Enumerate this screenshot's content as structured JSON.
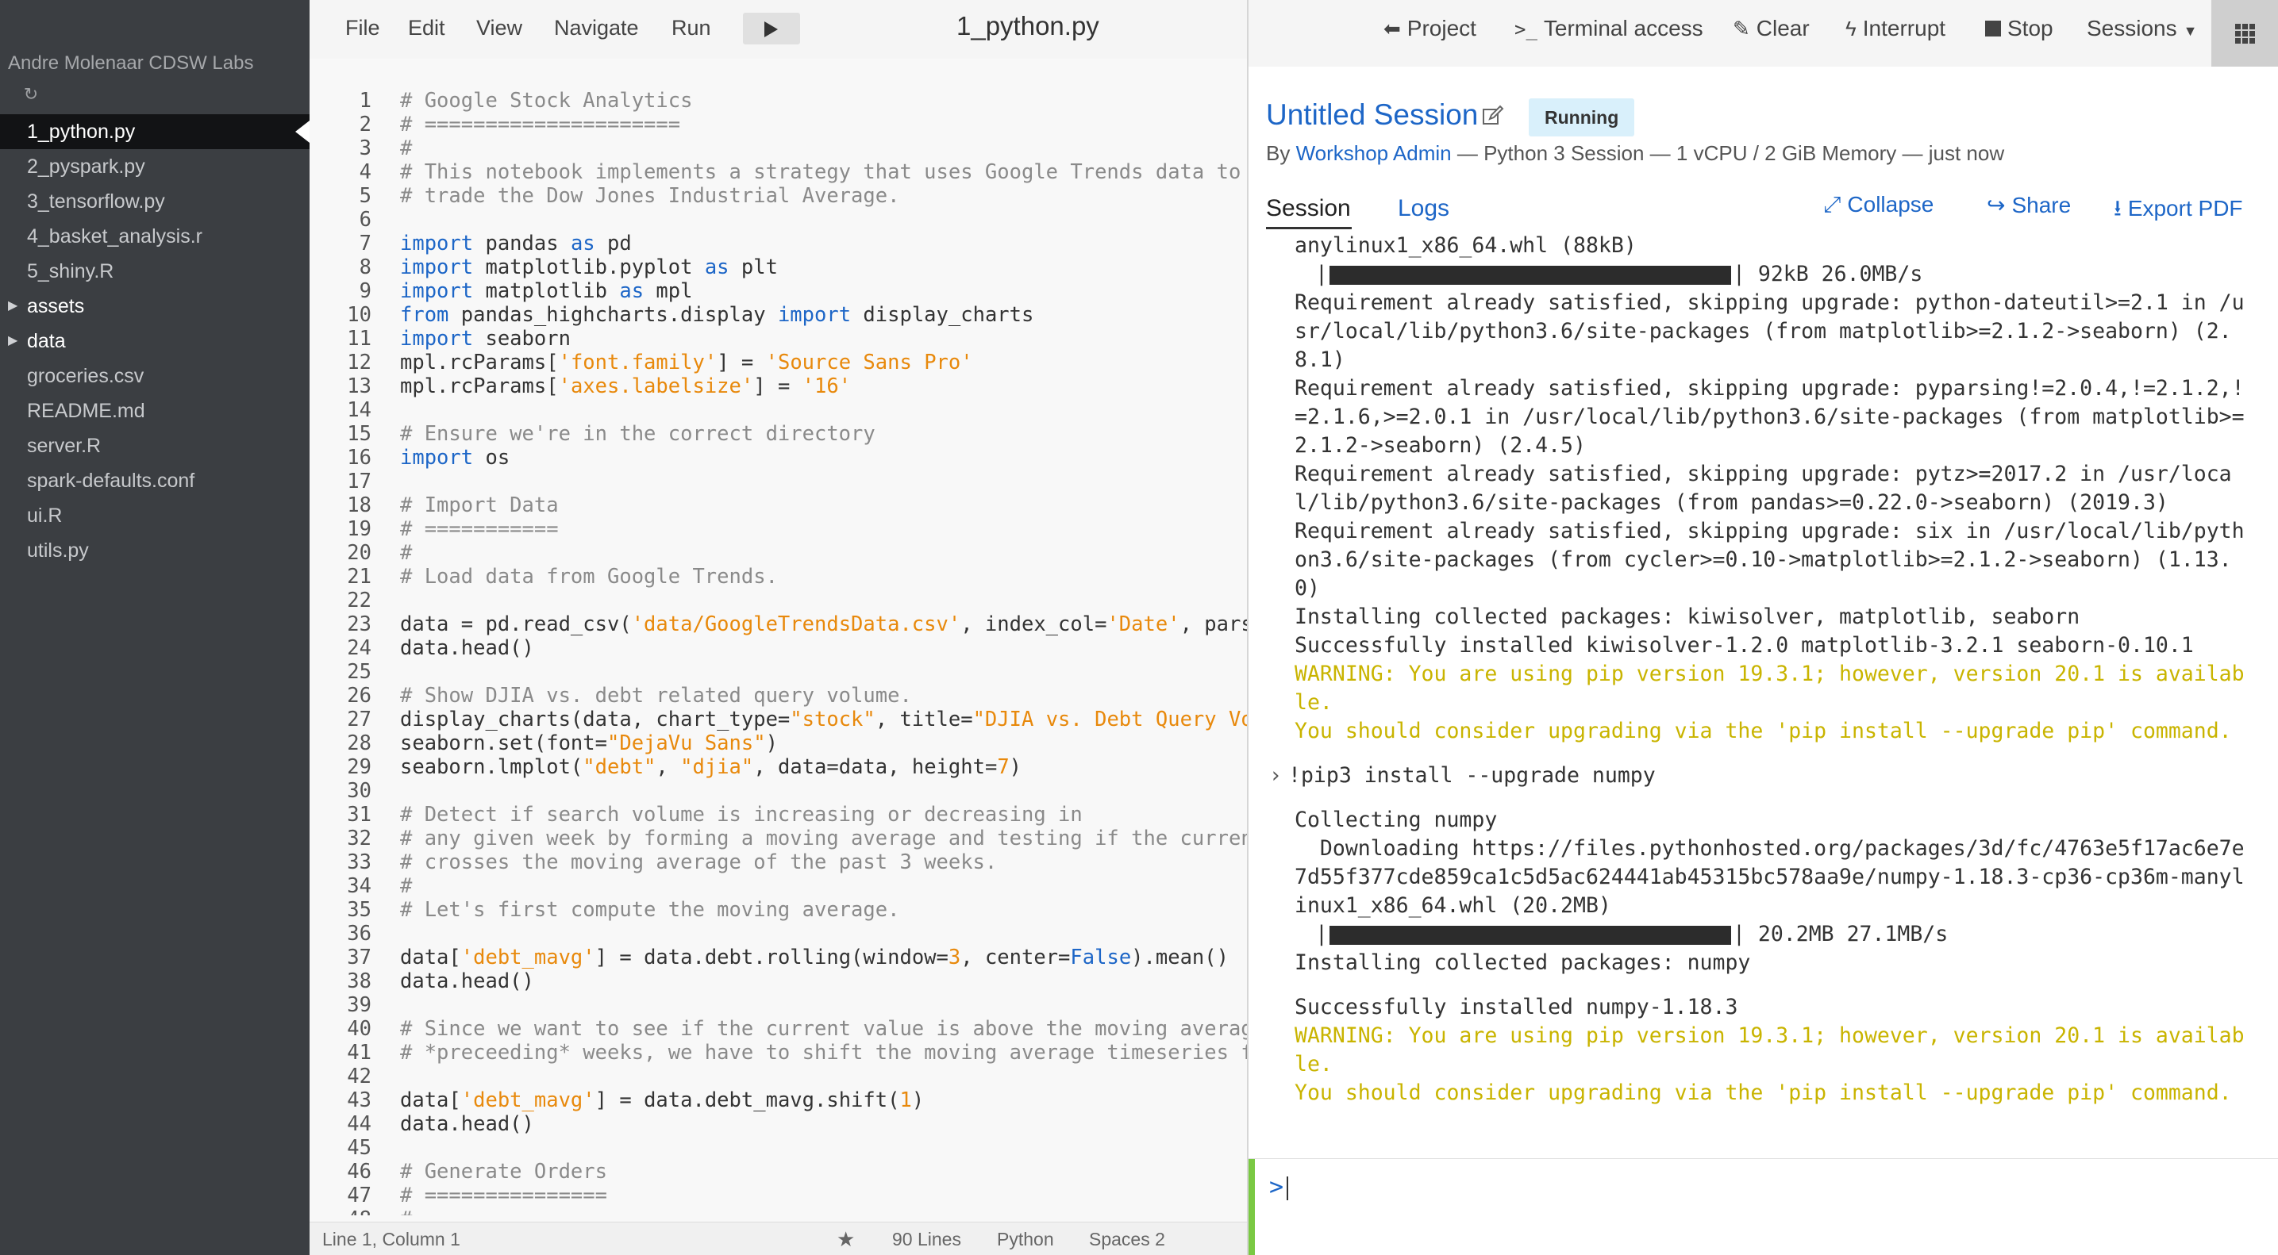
{
  "sidebar": {
    "project_title": "Andre Molenaar CDSW Labs",
    "refresh_icon": "refresh-icon",
    "files": [
      {
        "label": "1_python.py",
        "type": "file",
        "active": true
      },
      {
        "label": "2_pyspark.py",
        "type": "file"
      },
      {
        "label": "3_tensorflow.py",
        "type": "file"
      },
      {
        "label": "4_basket_analysis.r",
        "type": "file"
      },
      {
        "label": "5_shiny.R",
        "type": "file"
      },
      {
        "label": "assets",
        "type": "folder"
      },
      {
        "label": "data",
        "type": "folder"
      },
      {
        "label": "groceries.csv",
        "type": "file"
      },
      {
        "label": "README.md",
        "type": "file"
      },
      {
        "label": "server.R",
        "type": "file"
      },
      {
        "label": "spark-defaults.conf",
        "type": "file"
      },
      {
        "label": "ui.R",
        "type": "file"
      },
      {
        "label": "utils.py",
        "type": "file"
      }
    ]
  },
  "editor": {
    "menu": {
      "file": "File",
      "edit": "Edit",
      "view": "View",
      "navigate": "Navigate",
      "run": "Run"
    },
    "file_title": "1_python.py",
    "code_lines": [
      "# Google Stock Analytics",
      "# =====================",
      "#",
      "# This notebook implements a strategy that uses Google Trends data to",
      "# trade the Dow Jones Industrial Average.",
      "",
      "import pandas as pd",
      "import matplotlib.pyplot as plt",
      "import matplotlib as mpl",
      "from pandas_highcharts.display import display_charts",
      "import seaborn",
      "mpl.rcParams['font.family'] = 'Source Sans Pro'",
      "mpl.rcParams['axes.labelsize'] = '16'",
      "",
      "# Ensure we're in the correct directory",
      "import os",
      "",
      "# Import Data",
      "# ===========",
      "#",
      "# Load data from Google Trends.",
      "",
      "data = pd.read_csv('data/GoogleTrendsData.csv', index_col='Date', parse_dates=True)",
      "data.head()",
      "",
      "# Show DJIA vs. debt related query volume.",
      "display_charts(data, chart_type=\"stock\", title=\"DJIA vs. Debt Query Volume\", secondary_y=\"debt\")",
      "seaborn.set(font=\"DejaVu Sans\")",
      "seaborn.lmplot(\"debt\", \"djia\", data=data, height=7)",
      "",
      "# Detect if search volume is increasing or decreasing in",
      "# any given week by forming a moving average and testing if the current value",
      "# crosses the moving average of the past 3 weeks.",
      "#",
      "# Let's first compute the moving average.",
      "",
      "data['debt_mavg'] = data.debt.rolling(window=3, center=False).mean()",
      "data.head()",
      "",
      "# Since we want to see if the current value is above the moving average of the",
      "# *preceeding* weeks, we have to shift the moving average timeseries forward by one.",
      "",
      "data['debt_mavg'] = data.debt_mavg.shift(1)",
      "data.head()",
      "",
      "# Generate Orders",
      "# ===============",
      "#"
    ],
    "status": {
      "position": "Line 1, Column 1",
      "lines": "90 Lines",
      "language": "Python",
      "indent": "Spaces  2"
    }
  },
  "session": {
    "actions": {
      "project": "Project",
      "terminal": "Terminal access",
      "clear": "Clear",
      "interrupt": "Interrupt",
      "stop": "Stop",
      "sessions": "Sessions"
    },
    "title": "Untitled Session",
    "status": "Running",
    "meta_prefix": "By ",
    "author": "Workshop Admin",
    "meta_rest": " — Python 3 Session — 1 vCPU / 2 GiB Memory — just now",
    "tabs": {
      "session": "Session",
      "logs": "Logs"
    },
    "panel_actions": {
      "collapse": "Collapse",
      "share": "Share",
      "export": "Export PDF"
    },
    "output_block1": [
      {
        "t": "anylinux1_x86_64.whl (88kB)"
      },
      {
        "t": "92kB 26.0MB/s",
        "bar": true
      },
      {
        "t": "Requirement already satisfied, skipping upgrade: python-dateutil>=2.1 in /u"
      },
      {
        "t": "sr/local/lib/python3.6/site-packages (from matplotlib>=2.1.2->seaborn) (2."
      },
      {
        "t": "8.1)"
      },
      {
        "t": "Requirement already satisfied, skipping upgrade: pyparsing!=2.0.4,!=2.1.2,!"
      },
      {
        "t": "=2.1.6,>=2.0.1 in /usr/local/lib/python3.6/site-packages (from matplotlib>="
      },
      {
        "t": "2.1.2->seaborn) (2.4.5)"
      },
      {
        "t": "Requirement already satisfied, skipping upgrade: pytz>=2017.2 in /usr/loca"
      },
      {
        "t": "l/lib/python3.6/site-packages (from pandas>=0.22.0->seaborn) (2019.3)"
      },
      {
        "t": "Requirement already satisfied, skipping upgrade: six in /usr/local/lib/pyth"
      },
      {
        "t": "on3.6/site-packages (from cycler>=0.10->matplotlib>=2.1.2->seaborn) (1.13."
      },
      {
        "t": "0)"
      },
      {
        "t": "Installing collected packages: kiwisolver, matplotlib, seaborn"
      },
      {
        "t": "Successfully installed kiwisolver-1.2.0 matplotlib-3.2.1 seaborn-0.10.1"
      },
      {
        "t": "WARNING: You are using pip version 19.3.1; however, version 20.1 is availab",
        "warn": true
      },
      {
        "t": "le.",
        "warn": true
      },
      {
        "t": "You should consider upgrading via the 'pip install --upgrade pip' command.",
        "warn": true
      }
    ],
    "command": "!pip3 install --upgrade numpy",
    "output_block2": [
      {
        "t": "Collecting numpy"
      },
      {
        "t": "  Downloading https://files.pythonhosted.org/packages/3d/fc/4763e5f17ac6e7e"
      },
      {
        "t": "7d55f377cde859ca1c5d5ac624441ab45315bc578aa9e/numpy-1.18.3-cp36-cp36m-manyl"
      },
      {
        "t": "inux1_x86_64.whl (20.2MB)"
      },
      {
        "t": "20.2MB 27.1MB/s",
        "bar": true
      },
      {
        "t": "Installing collected packages: numpy"
      }
    ],
    "output_block3": [
      {
        "t": "Successfully installed numpy-1.18.3"
      },
      {
        "t": "WARNING: You are using pip version 19.3.1; however, version 20.1 is availab",
        "warn": true
      },
      {
        "t": "le.",
        "warn": true
      },
      {
        "t": "You should consider upgrading via the 'pip install --upgrade pip' command.",
        "warn": true
      }
    ],
    "input_prompt": ">"
  },
  "colors": {
    "sidebar_bg": "#3b3e42",
    "accent_blue": "#1d66c7",
    "string_orange": "#e8890c",
    "warning_yellow": "#c9b400",
    "running_badge": "#d9f0fb",
    "input_accent_green": "#7ac943"
  }
}
